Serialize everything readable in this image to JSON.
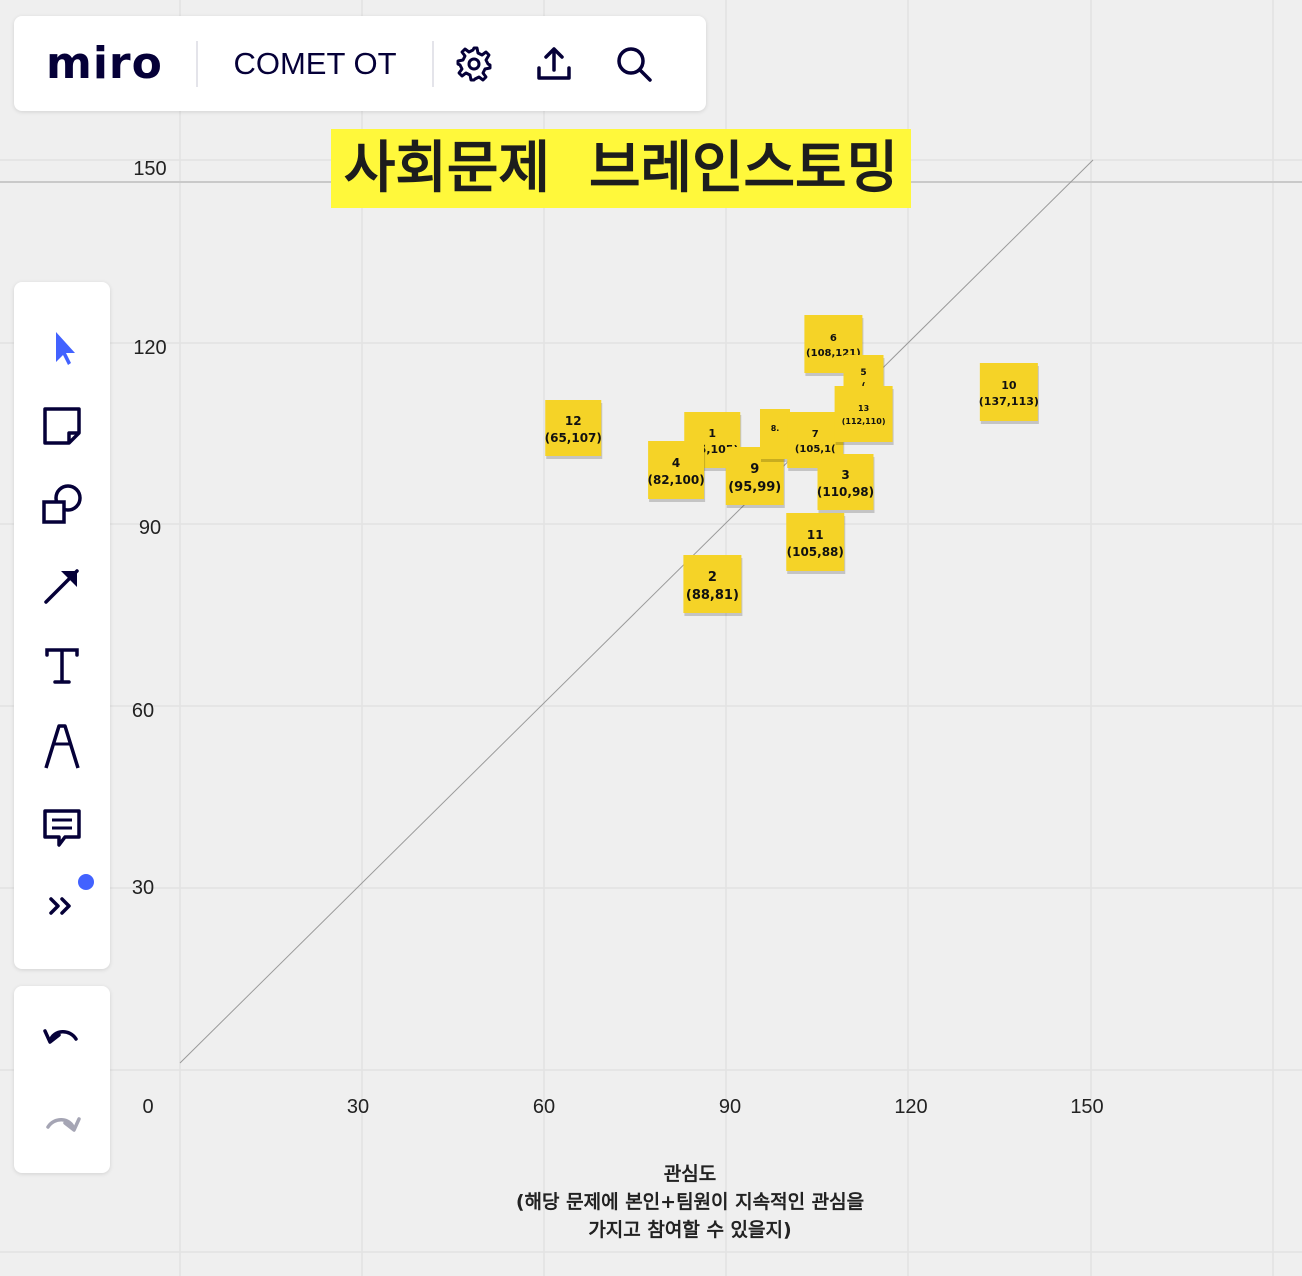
{
  "app": {
    "logo_text": "miro",
    "board_name": "COMET OT"
  },
  "toolbar": {
    "icons": [
      "gear-icon",
      "upload-icon",
      "search-icon"
    ]
  },
  "heading": "사회문제  브레인스토밍",
  "axis_title": {
    "line1": "관심도",
    "line2": "(해당 문제에 본인+팀원이 지속적인 관심을",
    "line3": "가지고 참여할 수 있을지)"
  },
  "colors": {
    "sticky": "#f5d327",
    "highlight": "#fff83b",
    "accent": "#4262ff",
    "brand": "#050038"
  },
  "chart_data": {
    "type": "scatter",
    "x_ticks": [
      "0",
      "30",
      "60",
      "90",
      "120",
      "150"
    ],
    "y_ticks": [
      "150",
      "120",
      "90",
      "60",
      "30"
    ],
    "xlim": [
      0,
      150
    ],
    "ylim": [
      0,
      150
    ],
    "reference_line": "y = x",
    "points": [
      {
        "id": "12",
        "label": "12",
        "coord": "(65,107)",
        "x": 65,
        "y": 107
      },
      {
        "id": "1",
        "label": "1",
        "coord": "(85,105)",
        "x": 85,
        "y": 105
      },
      {
        "id": "4",
        "label": "4",
        "coord": "(82,100)",
        "x": 82,
        "y": 100
      },
      {
        "id": "2",
        "label": "2",
        "coord": "(88,81)",
        "x": 88,
        "y": 81
      },
      {
        "id": "9",
        "label": "9",
        "coord": "(95,99)",
        "x": 95,
        "y": 99
      },
      {
        "id": "8",
        "label": "8.",
        "coord": "",
        "x": 100,
        "y": 105
      },
      {
        "id": "6",
        "label": "6",
        "coord": "(108,121)",
        "x": 108,
        "y": 121
      },
      {
        "id": "5",
        "label": "5",
        "coord": "(",
        "x": 110,
        "y": 114
      },
      {
        "id": "7",
        "label": "7",
        "coord": "(105,1(",
        "x": 105,
        "y": 105
      },
      {
        "id": "13",
        "label": "13",
        "coord": "(112,110)",
        "x": 112,
        "y": 110
      },
      {
        "id": "3",
        "label": "3",
        "coord": "(110,98)",
        "x": 110,
        "y": 98
      },
      {
        "id": "11",
        "label": "11",
        "coord": "(105,88)",
        "x": 105,
        "y": 88
      },
      {
        "id": "10",
        "label": "10",
        "coord": "(137,113)",
        "x": 137,
        "y": 113
      }
    ]
  },
  "left_toolbar": {
    "tools": [
      "select-arrow-icon",
      "sticky-note-icon",
      "shapes-icon",
      "arrow-line-icon",
      "text-tool-icon",
      "pen-icon",
      "comment-icon",
      "more-tools-icon"
    ],
    "undo": "undo-icon",
    "redo": "redo-icon"
  }
}
